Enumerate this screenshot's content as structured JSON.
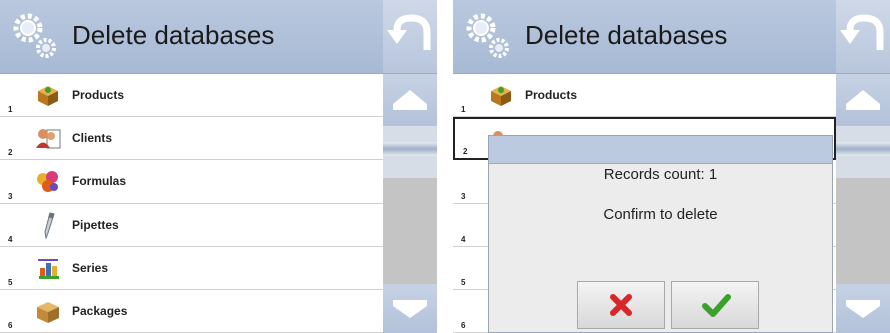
{
  "screens": [
    {
      "title": "Delete databases",
      "items": [
        {
          "num": "1",
          "label": "Products",
          "icon": "box-icon"
        },
        {
          "num": "2",
          "label": "Clients",
          "icon": "clients-icon"
        },
        {
          "num": "3",
          "label": "Formulas",
          "icon": "formulas-icon"
        },
        {
          "num": "4",
          "label": "Pipettes",
          "icon": "pipette-icon"
        },
        {
          "num": "5",
          "label": "Series",
          "icon": "series-icon"
        },
        {
          "num": "6",
          "label": "Packages",
          "icon": "package-icon"
        }
      ]
    },
    {
      "title": "Delete databases",
      "items": [
        {
          "num": "1",
          "label": "Products",
          "icon": "box-icon"
        },
        {
          "num": "2",
          "label": "",
          "icon": "clients-icon"
        },
        {
          "num": "3",
          "label": "",
          "icon": ""
        },
        {
          "num": "4",
          "label": "",
          "icon": ""
        },
        {
          "num": "5",
          "label": "",
          "icon": ""
        },
        {
          "num": "6",
          "label": "",
          "icon": ""
        }
      ],
      "dialog": {
        "records_text": "Records count: 1",
        "confirm_text": "Confirm to delete",
        "cancel_icon": "cross-icon",
        "confirm_icon": "checkmark-icon"
      }
    }
  ],
  "colors": {
    "header": "#b3c3dc",
    "cancel": "#d8262a",
    "confirm": "#3aa12a"
  }
}
